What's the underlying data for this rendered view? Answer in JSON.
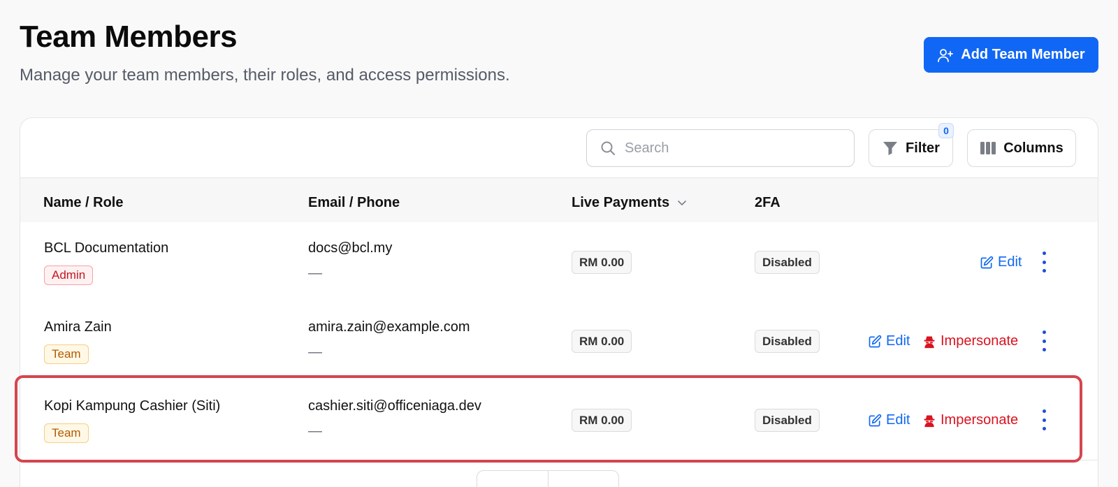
{
  "header": {
    "title": "Team Members",
    "subtitle": "Manage your team members, their roles, and access permissions.",
    "add_button": "Add Team Member"
  },
  "toolbar": {
    "search_placeholder": "Search",
    "filter_label": "Filter",
    "filter_count": "0",
    "columns_label": "Columns"
  },
  "table": {
    "columns": [
      "Name / Role",
      "Email / Phone",
      "Live Payments",
      "2FA"
    ],
    "rows": [
      {
        "name": "BCL Documentation",
        "role": "Admin",
        "email": "docs@bcl.my",
        "phone": "—",
        "live_payments": "RM 0.00",
        "twofa": "Disabled",
        "edit": "Edit",
        "impersonate": ""
      },
      {
        "name": "Amira Zain",
        "role": "Team",
        "email": "amira.zain@example.com",
        "phone": "—",
        "live_payments": "RM 0.00",
        "twofa": "Disabled",
        "edit": "Edit",
        "impersonate": "Impersonate"
      },
      {
        "name": "Kopi Kampung Cashier (Siti)",
        "role": "Team",
        "email": "cashier.siti@officeniaga.dev",
        "phone": "—",
        "live_payments": "RM 0.00",
        "twofa": "Disabled",
        "edit": "Edit",
        "impersonate": "Impersonate"
      }
    ]
  },
  "colors": {
    "primary": "#1167f5",
    "danger": "#d9131f",
    "highlight": "#d5454f"
  }
}
